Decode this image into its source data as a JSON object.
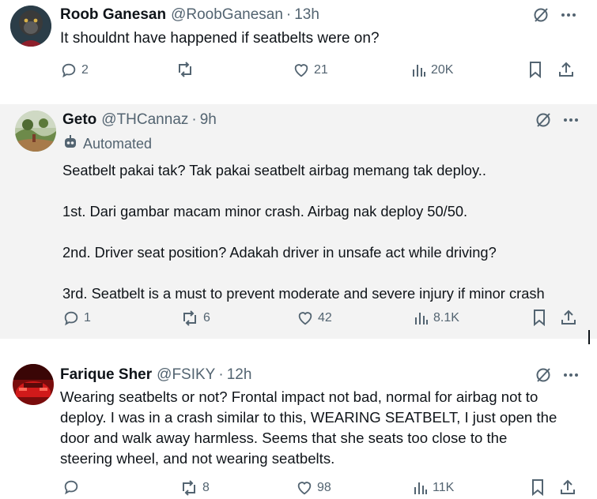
{
  "tweets": [
    {
      "name": "Roob Ganesan",
      "handle": "@RoobGanesan",
      "dot": "·",
      "time": "13h",
      "text": "It shouldnt have happened if seatbelts were on?",
      "replies": "2",
      "reposts": "",
      "likes": "21",
      "views": "20K",
      "avatar": "gorilla-avatar"
    },
    {
      "name": "Geto",
      "handle": "@THCannaz",
      "dot": "·",
      "time": "9h",
      "automated_label": "Automated",
      "text": "Seatbelt pakai tak? Tak pakai seatbelt airbag memang tak deploy..\n\n1st. Dari gambar macam minor crash. Airbag nak deploy 50/50.\n\n2nd. Driver seat position? Adakah driver in unsafe act while driving?\n\n3rd. Seatbelt is a must to prevent moderate and severe injury if minor crash",
      "replies": "1",
      "reposts": "6",
      "likes": "42",
      "views": "8.1K",
      "avatar": "landscape-avatar"
    },
    {
      "name": "Farique Sher",
      "handle": "@FSIKY",
      "dot": "·",
      "time": "12h",
      "text": "Wearing seatbelts or not? Frontal impact not bad, normal for airbag not to\ndeploy. I was in a crash similar to this, WEARING SEATBELT, I just open the\ndoor and walk away harmless. Seems that she seats too close to the\nsteering wheel, and not wearing seatbelts.",
      "replies": "",
      "reposts": "8",
      "likes": "98",
      "views": "11K",
      "avatar": "red-car-avatar"
    }
  ],
  "colors": {
    "text": "#0f1419",
    "secondary": "#536471",
    "gray_bg": "#f3f3f3"
  }
}
